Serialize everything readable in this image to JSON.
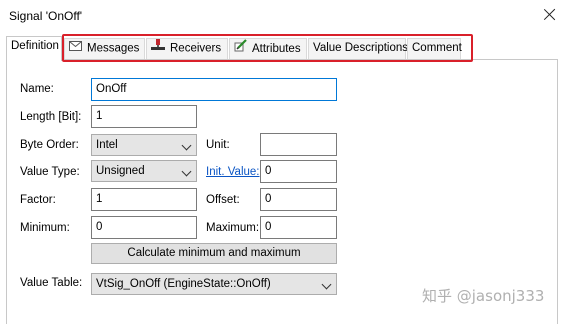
{
  "window": {
    "title": "Signal 'OnOff'",
    "close_icon": "close-icon"
  },
  "tabs": [
    {
      "label": "Definition",
      "active": true
    },
    {
      "label": "Messages",
      "icon": "envelope-icon"
    },
    {
      "label": "Receivers",
      "icon": "receiver-node-icon"
    },
    {
      "label": "Attributes",
      "icon": "pencil-attributes-icon"
    },
    {
      "label": "Value Descriptions"
    },
    {
      "label": "Comment"
    }
  ],
  "highlight_color": "#d9202a",
  "form": {
    "name_label": "Name:",
    "name_value": "OnOff",
    "length_label": "Length [Bit]:",
    "length_value": "1",
    "byte_order_label": "Byte Order:",
    "byte_order_value": "Intel",
    "unit_label": "Unit:",
    "unit_value": "",
    "value_type_label": "Value Type:",
    "value_type_value": "Unsigned",
    "init_value_label": "Init. Value:",
    "init_value_value": "0",
    "factor_label": "Factor:",
    "factor_value": "1",
    "offset_label": "Offset:",
    "offset_value": "0",
    "minimum_label": "Minimum:",
    "minimum_value": "0",
    "maximum_label": "Maximum:",
    "maximum_value": "0",
    "calc_button_label": "Calculate minimum and maximum",
    "value_table_label": "Value Table:",
    "value_table_value": "VtSig_OnOff (EngineState::OnOff)"
  },
  "watermark": "知乎 @jasonj333"
}
